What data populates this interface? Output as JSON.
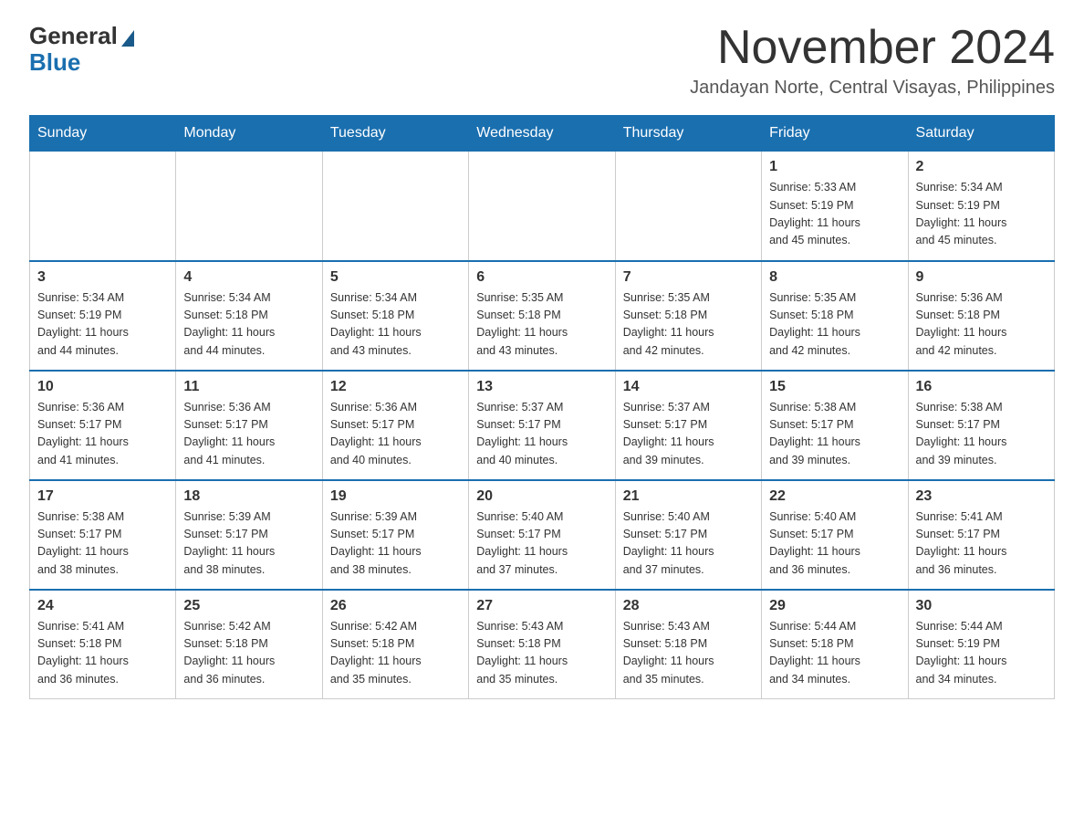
{
  "header": {
    "logo_general": "General",
    "logo_blue": "Blue",
    "title": "November 2024",
    "subtitle": "Jandayan Norte, Central Visayas, Philippines"
  },
  "weekdays": [
    "Sunday",
    "Monday",
    "Tuesday",
    "Wednesday",
    "Thursday",
    "Friday",
    "Saturday"
  ],
  "weeks": [
    [
      {
        "day": "",
        "info": ""
      },
      {
        "day": "",
        "info": ""
      },
      {
        "day": "",
        "info": ""
      },
      {
        "day": "",
        "info": ""
      },
      {
        "day": "",
        "info": ""
      },
      {
        "day": "1",
        "info": "Sunrise: 5:33 AM\nSunset: 5:19 PM\nDaylight: 11 hours\nand 45 minutes."
      },
      {
        "day": "2",
        "info": "Sunrise: 5:34 AM\nSunset: 5:19 PM\nDaylight: 11 hours\nand 45 minutes."
      }
    ],
    [
      {
        "day": "3",
        "info": "Sunrise: 5:34 AM\nSunset: 5:19 PM\nDaylight: 11 hours\nand 44 minutes."
      },
      {
        "day": "4",
        "info": "Sunrise: 5:34 AM\nSunset: 5:18 PM\nDaylight: 11 hours\nand 44 minutes."
      },
      {
        "day": "5",
        "info": "Sunrise: 5:34 AM\nSunset: 5:18 PM\nDaylight: 11 hours\nand 43 minutes."
      },
      {
        "day": "6",
        "info": "Sunrise: 5:35 AM\nSunset: 5:18 PM\nDaylight: 11 hours\nand 43 minutes."
      },
      {
        "day": "7",
        "info": "Sunrise: 5:35 AM\nSunset: 5:18 PM\nDaylight: 11 hours\nand 42 minutes."
      },
      {
        "day": "8",
        "info": "Sunrise: 5:35 AM\nSunset: 5:18 PM\nDaylight: 11 hours\nand 42 minutes."
      },
      {
        "day": "9",
        "info": "Sunrise: 5:36 AM\nSunset: 5:18 PM\nDaylight: 11 hours\nand 42 minutes."
      }
    ],
    [
      {
        "day": "10",
        "info": "Sunrise: 5:36 AM\nSunset: 5:17 PM\nDaylight: 11 hours\nand 41 minutes."
      },
      {
        "day": "11",
        "info": "Sunrise: 5:36 AM\nSunset: 5:17 PM\nDaylight: 11 hours\nand 41 minutes."
      },
      {
        "day": "12",
        "info": "Sunrise: 5:36 AM\nSunset: 5:17 PM\nDaylight: 11 hours\nand 40 minutes."
      },
      {
        "day": "13",
        "info": "Sunrise: 5:37 AM\nSunset: 5:17 PM\nDaylight: 11 hours\nand 40 minutes."
      },
      {
        "day": "14",
        "info": "Sunrise: 5:37 AM\nSunset: 5:17 PM\nDaylight: 11 hours\nand 39 minutes."
      },
      {
        "day": "15",
        "info": "Sunrise: 5:38 AM\nSunset: 5:17 PM\nDaylight: 11 hours\nand 39 minutes."
      },
      {
        "day": "16",
        "info": "Sunrise: 5:38 AM\nSunset: 5:17 PM\nDaylight: 11 hours\nand 39 minutes."
      }
    ],
    [
      {
        "day": "17",
        "info": "Sunrise: 5:38 AM\nSunset: 5:17 PM\nDaylight: 11 hours\nand 38 minutes."
      },
      {
        "day": "18",
        "info": "Sunrise: 5:39 AM\nSunset: 5:17 PM\nDaylight: 11 hours\nand 38 minutes."
      },
      {
        "day": "19",
        "info": "Sunrise: 5:39 AM\nSunset: 5:17 PM\nDaylight: 11 hours\nand 38 minutes."
      },
      {
        "day": "20",
        "info": "Sunrise: 5:40 AM\nSunset: 5:17 PM\nDaylight: 11 hours\nand 37 minutes."
      },
      {
        "day": "21",
        "info": "Sunrise: 5:40 AM\nSunset: 5:17 PM\nDaylight: 11 hours\nand 37 minutes."
      },
      {
        "day": "22",
        "info": "Sunrise: 5:40 AM\nSunset: 5:17 PM\nDaylight: 11 hours\nand 36 minutes."
      },
      {
        "day": "23",
        "info": "Sunrise: 5:41 AM\nSunset: 5:17 PM\nDaylight: 11 hours\nand 36 minutes."
      }
    ],
    [
      {
        "day": "24",
        "info": "Sunrise: 5:41 AM\nSunset: 5:18 PM\nDaylight: 11 hours\nand 36 minutes."
      },
      {
        "day": "25",
        "info": "Sunrise: 5:42 AM\nSunset: 5:18 PM\nDaylight: 11 hours\nand 36 minutes."
      },
      {
        "day": "26",
        "info": "Sunrise: 5:42 AM\nSunset: 5:18 PM\nDaylight: 11 hours\nand 35 minutes."
      },
      {
        "day": "27",
        "info": "Sunrise: 5:43 AM\nSunset: 5:18 PM\nDaylight: 11 hours\nand 35 minutes."
      },
      {
        "day": "28",
        "info": "Sunrise: 5:43 AM\nSunset: 5:18 PM\nDaylight: 11 hours\nand 35 minutes."
      },
      {
        "day": "29",
        "info": "Sunrise: 5:44 AM\nSunset: 5:18 PM\nDaylight: 11 hours\nand 34 minutes."
      },
      {
        "day": "30",
        "info": "Sunrise: 5:44 AM\nSunset: 5:19 PM\nDaylight: 11 hours\nand 34 minutes."
      }
    ]
  ]
}
